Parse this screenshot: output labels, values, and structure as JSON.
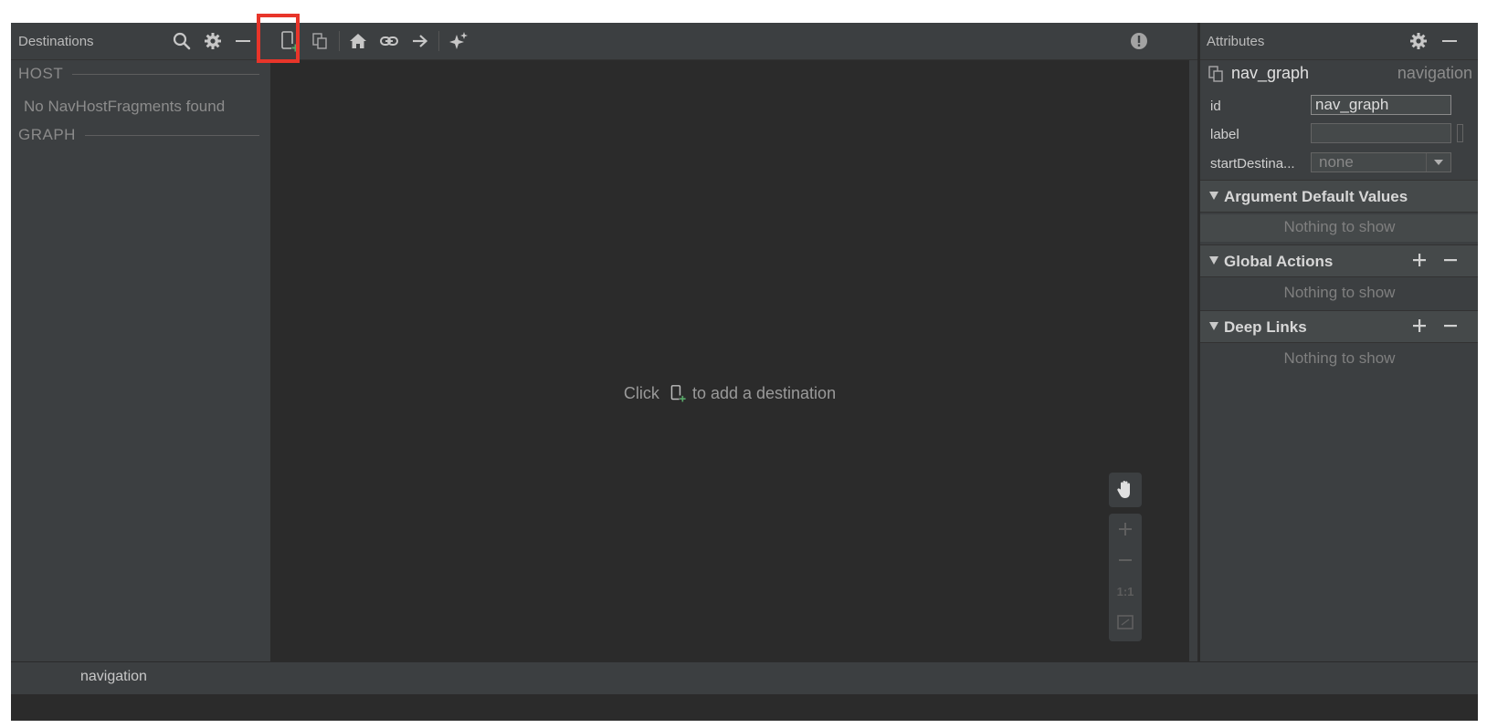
{
  "destinations": {
    "title": "Destinations",
    "host_section": "HOST",
    "host_empty": "No NavHostFragments found",
    "graph_section": "GRAPH"
  },
  "toolbar": {
    "icons": [
      "new-destination-icon",
      "nested-graph-icon",
      "home-icon",
      "deep-link-icon",
      "action-arrow-icon",
      "auto-arrange-icon",
      "warning-icon"
    ]
  },
  "canvas": {
    "hint_before": "Click",
    "hint_after": "to add a destination",
    "zoom_one_to_one": "1:1"
  },
  "attributes": {
    "title": "Attributes",
    "graph_name": "nav_graph",
    "graph_type": "navigation",
    "fields": {
      "id_label": "id",
      "id_value": "nav_graph",
      "label_label": "label",
      "label_value": "",
      "start_label": "startDestina...",
      "start_value": "none"
    },
    "sections": {
      "argument_defaults": "Argument Default Values",
      "global_actions": "Global Actions",
      "deep_links": "Deep Links",
      "empty_text": "Nothing to show"
    }
  },
  "status_bar": {
    "tab": "navigation"
  },
  "colors": {
    "accent_green": "#59a869",
    "highlight": "#e8352a"
  }
}
